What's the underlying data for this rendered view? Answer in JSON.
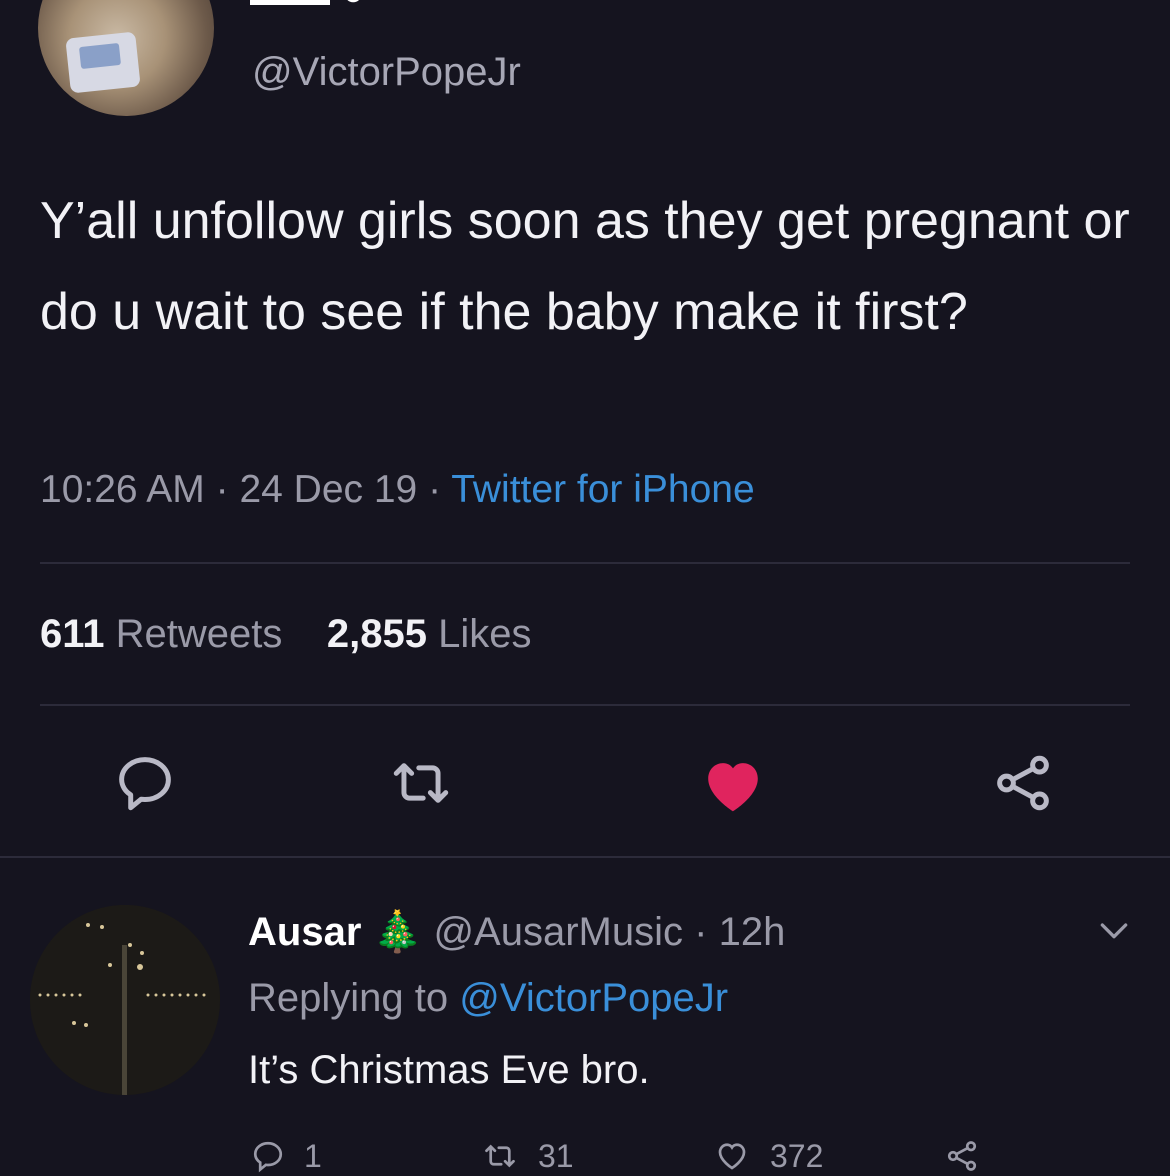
{
  "tweet": {
    "handle": "@VictorPopeJr",
    "text": "Y’all unfollow girls soon as they get pregnant or do u wait to see if the baby make it first?",
    "time": "10:26 AM",
    "date": "24 Dec 19",
    "source": "Twitter for iPhone",
    "retweets_count": "611",
    "retweets_label": "Retweets",
    "likes_count": "2,855",
    "likes_label": "Likes",
    "icons": [
      "reply-icon",
      "retweet-icon",
      "like-icon",
      "share-icon"
    ],
    "colors": {
      "like": "#e0245e",
      "link": "#3a8fd9",
      "background": "#15141f"
    }
  },
  "reply": {
    "name": "Ausar",
    "emoji": "🎄",
    "handle": "@AusarMusic",
    "age": "12h",
    "replying_prefix": "Replying to",
    "replying_to": "@VictorPopeJr",
    "text": "It’s Christmas Eve bro.",
    "reply_count": "1",
    "retweet_count": "31",
    "like_count": "372"
  }
}
